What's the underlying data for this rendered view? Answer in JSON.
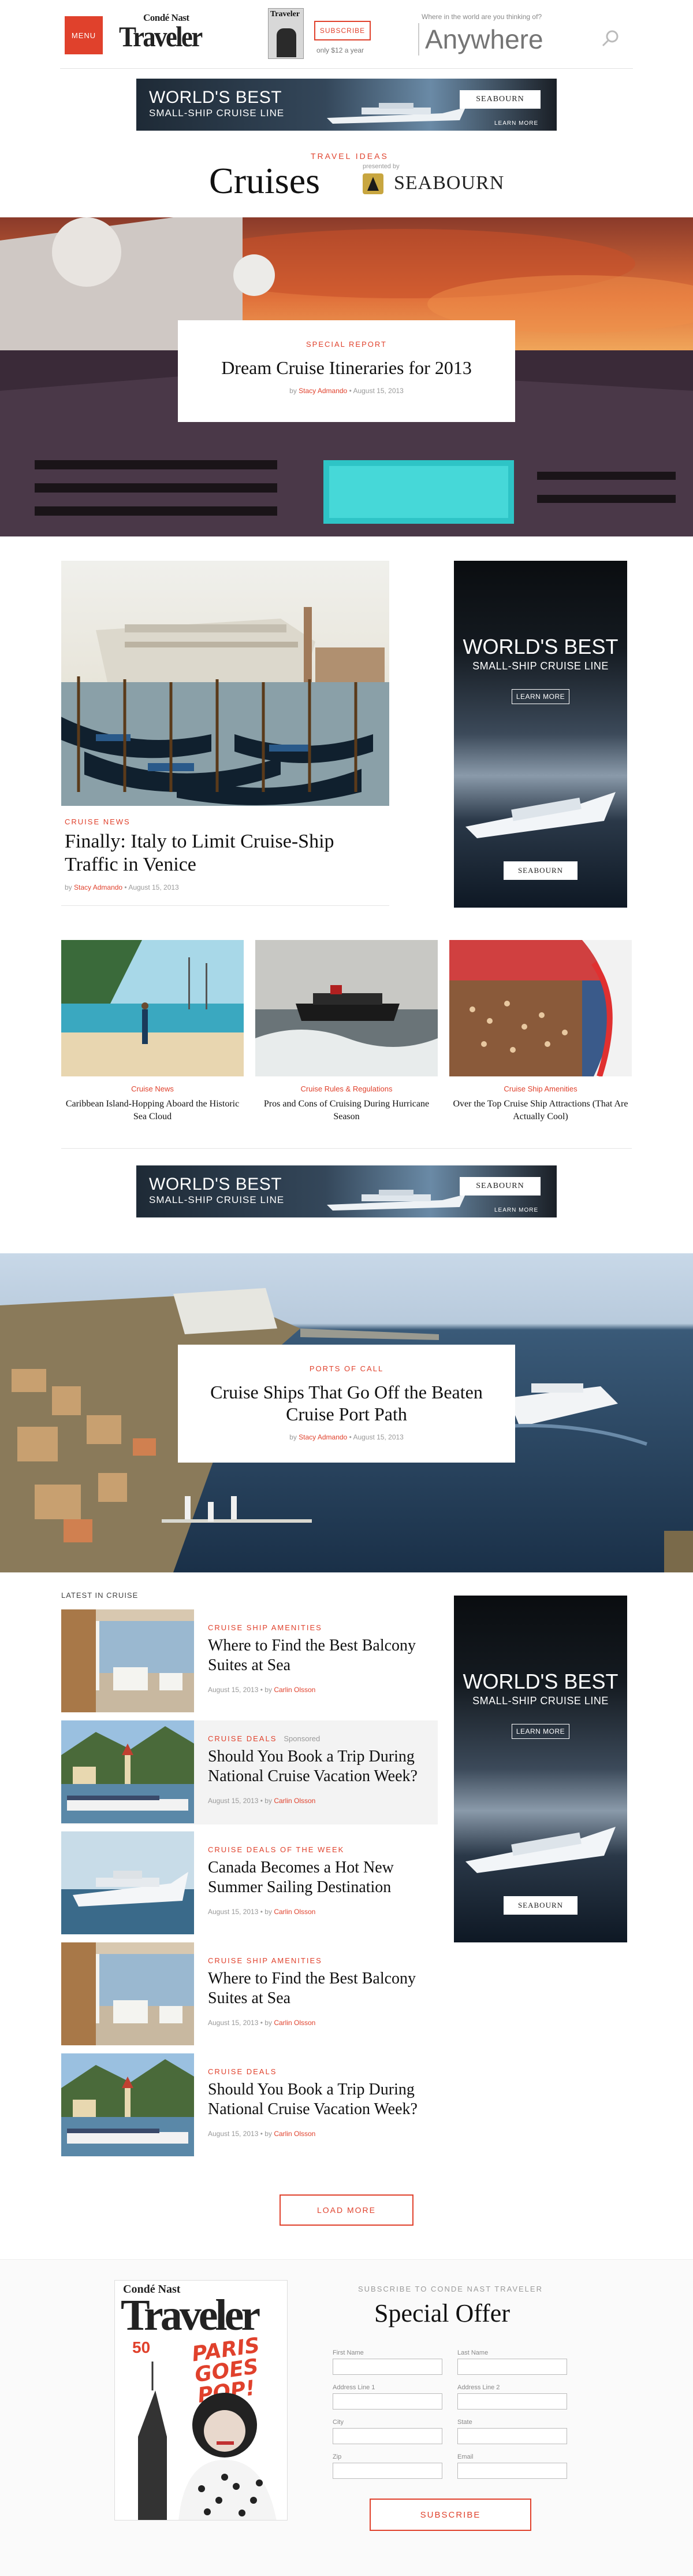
{
  "header": {
    "menu_label": "MENU",
    "logo_small": "Condé Nast",
    "logo_big": "Traveler",
    "subscribe_label": "SUBSCRIBE",
    "subscribe_price": "only $12 a year",
    "search_label": "Where in the world are you thinking of?",
    "search_placeholder": "Anywhere"
  },
  "ads": {
    "banner_title": "WORLD'S BEST",
    "banner_subtitle": "SMALL-SHIP CRUISE LINE",
    "brand": "SEABOURN",
    "learn_more": "LEARN MORE"
  },
  "section": {
    "kicker": "TRAVEL IDEAS",
    "title": "Cruises",
    "presented_by": "presented by",
    "sponsor": "SEABOURN"
  },
  "hero1": {
    "kicker": "SPECIAL REPORT",
    "title": "Dream Cruise Itineraries for 2013",
    "by": "by",
    "author": "Stacy Admando",
    "date": "August 15, 2013"
  },
  "feature": {
    "kicker": "CRUISE NEWS",
    "title": "Finally: Italy to Limit Cruise-Ship Traffic in Venice",
    "by": "by",
    "author": "Stacy Admando",
    "date": "August 15, 2013"
  },
  "cards": [
    {
      "kicker": "Cruise News",
      "title": "Caribbean Island-Hopping Aboard the Historic Sea Cloud"
    },
    {
      "kicker": "Cruise Rules & Regulations",
      "title": "Pros and Cons of Cruising During Hurricane Season"
    },
    {
      "kicker": "Cruise Ship Amenities",
      "title": "Over the Top Cruise Ship Attractions (That Are Actually Cool)"
    }
  ],
  "hero2": {
    "kicker": "PORTS OF CALL",
    "title": "Cruise Ships That Go Off the Beaten Cruise Port Path",
    "by": "by",
    "author": "Stacy Admando",
    "date": "August 15, 2013"
  },
  "latest": {
    "label": "LATEST IN CRUISE",
    "items": [
      {
        "kicker": "CRUISE SHIP AMENITIES",
        "sponsored": "",
        "title": "Where to Find the Best Balcony Suites at Sea",
        "date": "August 15, 2013",
        "by": "by",
        "author": "Carlin Olsson"
      },
      {
        "kicker": "CRUISE DEALS",
        "sponsored": "Sponsored",
        "title": "Should You Book a Trip During National Cruise Vacation Week?",
        "date": "August 15, 2013",
        "by": "by",
        "author": "Carlin Olsson"
      },
      {
        "kicker": "CRUISE DEALS OF THE WEEK",
        "sponsored": "",
        "title": "Canada Becomes a Hot New Summer Sailing Destination",
        "date": "August 15, 2013",
        "by": "by",
        "author": "Carlin Olsson"
      },
      {
        "kicker": "CRUISE SHIP AMENITIES",
        "sponsored": "",
        "title": "Where to Find the Best Balcony Suites at Sea",
        "date": "August 15, 2013",
        "by": "by",
        "author": "Carlin Olsson"
      },
      {
        "kicker": "CRUISE DEALS",
        "sponsored": "",
        "title": "Should You Book a Trip During National Cruise Vacation Week?",
        "date": "August 15, 2013",
        "by": "by",
        "author": "Carlin Olsson"
      }
    ],
    "load_more": "LOAD MORE"
  },
  "subscribe_footer": {
    "kicker": "SUBSCRIBE TO CONDE NAST TRAVELER",
    "title": "Special Offer",
    "cover_small": "Condé Nast",
    "cover_big": "Traveler",
    "cover_headline": "PARIS GOES POP!",
    "cover_number": "50",
    "fields": {
      "first_name": "First Name",
      "last_name": "Last Name",
      "address1": "Address Line 1",
      "address2": "Address Line 2",
      "city": "City",
      "state": "State",
      "zip": "Zip",
      "email": "Email"
    },
    "button": "SUBSCRIBE"
  },
  "colors": {
    "accent": "#e0412c"
  }
}
